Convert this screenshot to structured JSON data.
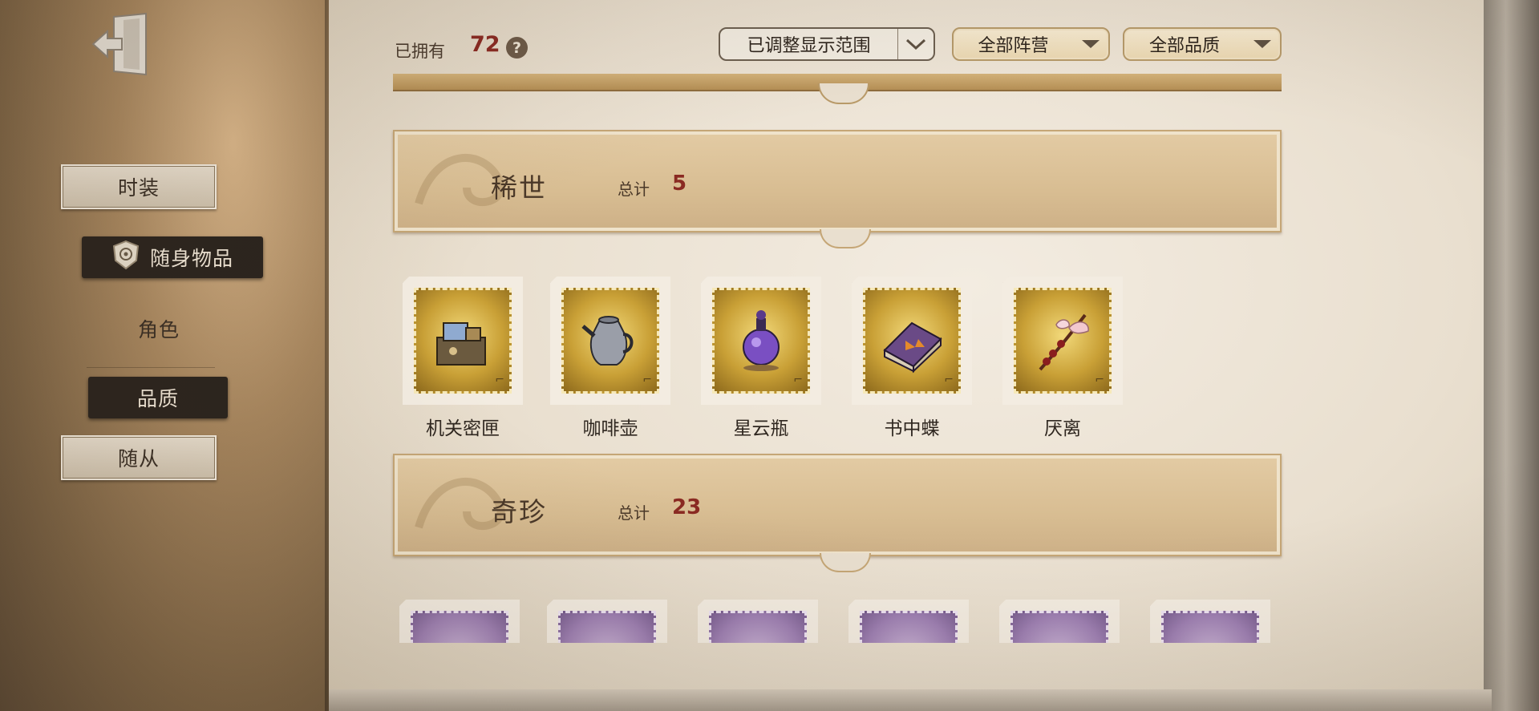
{
  "sidebar": {
    "items": [
      {
        "label": "时装",
        "style": "plaque"
      },
      {
        "label": "随身物品",
        "style": "dark-selected",
        "icon": "emblem-icon"
      },
      {
        "label": "角色",
        "style": "plain"
      },
      {
        "label": "品质",
        "style": "dark"
      },
      {
        "label": "随从",
        "style": "plaque"
      }
    ]
  },
  "header": {
    "owned_label": "已拥有",
    "owned_count": "72",
    "help": "?",
    "filters": {
      "range": "已调整显示范围",
      "camp": "全部阵营",
      "quality": "全部品质"
    }
  },
  "sections": [
    {
      "title": "稀世",
      "total_label": "总计",
      "total_value": "5",
      "items": [
        {
          "name": "机关密匣",
          "icon": "mechanism-box-icon"
        },
        {
          "name": "咖啡壶",
          "icon": "coffee-pot-icon"
        },
        {
          "name": "星云瓶",
          "icon": "nebula-bottle-icon"
        },
        {
          "name": "书中蝶",
          "icon": "butterfly-book-icon"
        },
        {
          "name": "厌离",
          "icon": "blossom-branch-icon"
        }
      ]
    },
    {
      "title": "奇珍",
      "total_label": "总计",
      "total_value": "23",
      "items": [
        {
          "icon": "ticket-icon"
        },
        {
          "icon": "chain-icon"
        },
        {
          "icon": "orb-icon"
        },
        {
          "icon": "flower-icon"
        },
        {
          "icon": "ring-icon"
        },
        {
          "icon": "crystal-icon"
        }
      ]
    }
  ],
  "colors": {
    "accent_red": "#8a2a22",
    "gold_stamp": "#c9a036",
    "purple_stamp": "#9e80b3",
    "banner": "#d8bd92"
  }
}
